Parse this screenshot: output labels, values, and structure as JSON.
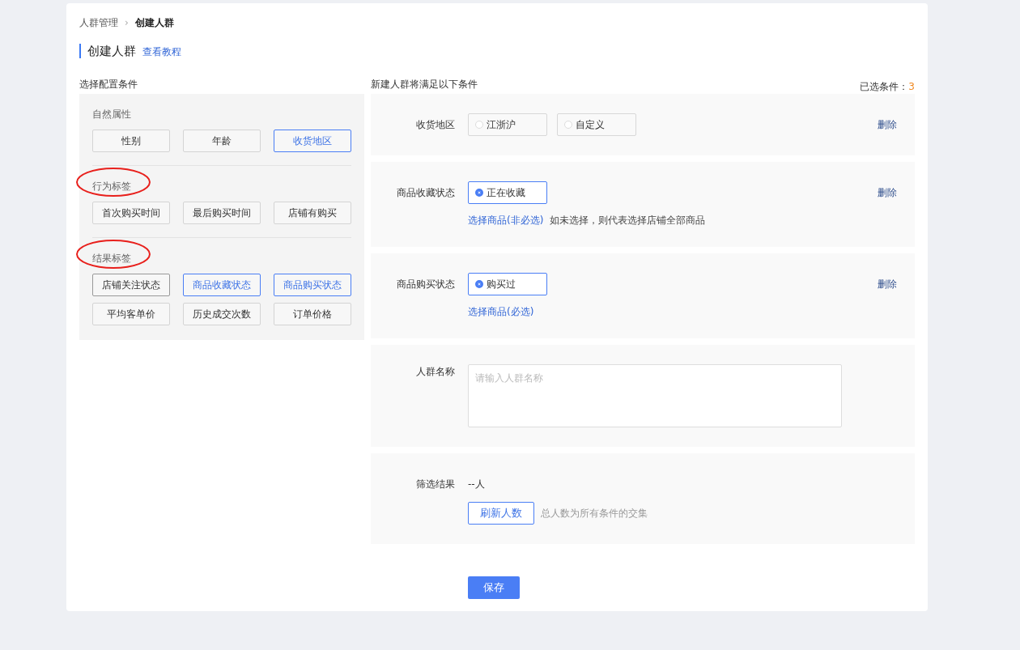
{
  "breadcrumb": [
    {
      "label": "人群管理",
      "current": false
    },
    {
      "label": "创建人群",
      "current": true
    }
  ],
  "separator": "›",
  "page_title": "创建人群",
  "tutorial_link": "查看教程",
  "left_panel": {
    "title": "选择配置条件",
    "groups": [
      {
        "title": "自然属性",
        "circled": false,
        "tags": [
          {
            "label": "性别",
            "selected": false,
            "hovered": false
          },
          {
            "label": "年龄",
            "selected": false,
            "hovered": false
          },
          {
            "label": "收货地区",
            "selected": true,
            "hovered": false
          }
        ]
      },
      {
        "title": "行为标签",
        "circled": true,
        "tags": [
          {
            "label": "首次购买时间",
            "selected": false,
            "hovered": false
          },
          {
            "label": "最后购买时间",
            "selected": false,
            "hovered": false
          },
          {
            "label": "店铺有购买",
            "selected": false,
            "hovered": false
          }
        ]
      },
      {
        "title": "结果标签",
        "circled": true,
        "tags": [
          {
            "label": "店铺关注状态",
            "selected": false,
            "hovered": true
          },
          {
            "label": "商品收藏状态",
            "selected": true,
            "hovered": false
          },
          {
            "label": "商品购买状态",
            "selected": true,
            "hovered": false
          },
          {
            "label": "平均客单价",
            "selected": false,
            "hovered": false
          },
          {
            "label": "历史成交次数",
            "selected": false,
            "hovered": false
          },
          {
            "label": "订单价格",
            "selected": false,
            "hovered": false
          }
        ]
      }
    ]
  },
  "right_panel": {
    "title": "新建人群将满足以下条件",
    "count_label": "已选条件：",
    "count": "3",
    "conditions": [
      {
        "label": "收货地区",
        "options": [
          {
            "label": "江浙沪",
            "selected": false
          },
          {
            "label": "自定义",
            "selected": false
          }
        ],
        "delete": "删除"
      },
      {
        "label": "商品收藏状态",
        "options": [
          {
            "label": "正在收藏",
            "selected": true
          }
        ],
        "delete": "删除",
        "note_link": "选择商品(非必选)",
        "note": "如未选择，则代表选择店铺全部商品"
      },
      {
        "label": "商品购买状态",
        "options": [
          {
            "label": "购买过",
            "selected": true
          }
        ],
        "delete": "删除",
        "note_link": "选择商品(必选)"
      }
    ],
    "name_field": {
      "label": "人群名称",
      "placeholder": "请输入人群名称"
    },
    "result": {
      "label": "筛选结果",
      "value": "--人",
      "refresh_button": "刷新人数",
      "hint": "总人数为所有条件的交集"
    },
    "save_button": "保存"
  }
}
